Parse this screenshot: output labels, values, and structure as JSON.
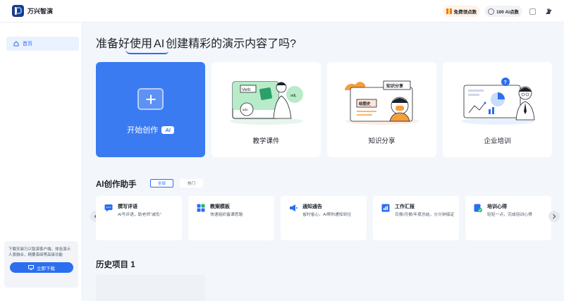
{
  "app": {
    "name": "万兴智演"
  },
  "topbar": {
    "free_points_label": "免费领点数",
    "points_label": "100 AI点数"
  },
  "sidebar": {
    "items": [
      {
        "label": "首页",
        "icon": "home-icon",
        "active": true
      }
    ],
    "download": {
      "text": "下载安装万兴智演客户端，体验演示人景融合，精要演绎等高级功能",
      "button_label": "立即下载"
    }
  },
  "main": {
    "headline": {
      "before": "准备好使用 ",
      "ai": "AI",
      "after": " 创建精彩的演示内容了吗?"
    },
    "start_card": {
      "label": "开始创作",
      "badge": "AI"
    },
    "cards": [
      {
        "label": "教学课件",
        "words": [
          "Verb",
          "adj.",
          "adv."
        ]
      },
      {
        "label": "知识分享",
        "words": [
          "知识分享",
          "绘图史"
        ]
      },
      {
        "label": "企业培训",
        "words": [
          "?"
        ]
      }
    ],
    "assistant": {
      "title": "AI创作助手",
      "filters": [
        "全部",
        "热门"
      ],
      "tools": [
        {
          "title": "撰写评语",
          "desc": "AI写评语，助老师\"减负\"",
          "icon_color": "#2b6ef0",
          "icon": "comment-icon"
        },
        {
          "title": "教案模板",
          "desc": "快速组织备课思路",
          "icon_color": "#2b6ef0",
          "icon": "grid-icon"
        },
        {
          "title": "通知通告",
          "desc": "省时省心，AI帮你通知到位",
          "icon_color": "#2b6ef0",
          "icon": "megaphone-icon"
        },
        {
          "title": "工作汇报",
          "desc": "日报/月报/年度总结，分分钟搞定",
          "icon_color": "#2b6ef0",
          "icon": "report-icon"
        },
        {
          "title": "培训心得",
          "desc": "轻轻一点，完成培训心得",
          "icon_color": "#2b6ef0",
          "icon": "check-doc-icon"
        }
      ]
    },
    "history": {
      "title": "历史项目 1"
    }
  }
}
